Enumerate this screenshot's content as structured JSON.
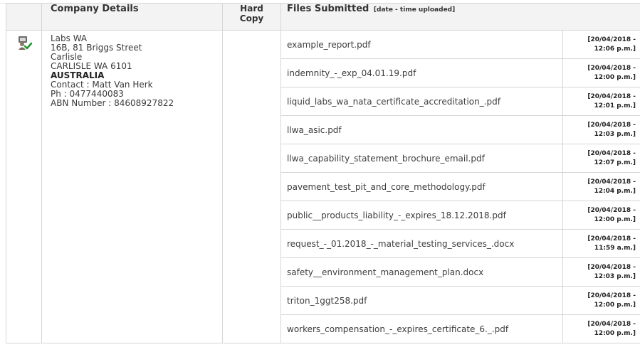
{
  "table": {
    "headers": {
      "company_details": "Company Details",
      "hard_copy_line1": "Hard",
      "hard_copy_line2": "Copy",
      "files_submitted": "Files Submitted",
      "files_submitted_sub": "[date - time uploaded]"
    },
    "row_icon": "user-check-icon",
    "company": {
      "name": "Labs WA",
      "address_line1": "16B, 81 Briggs Street",
      "suburb": "Carlisle",
      "city_state_postcode": "CARLISLE  WA 6101",
      "country": "AUSTRALIA",
      "contact": "Contact : Matt Van Herk",
      "phone": "Ph : 0477440083",
      "abn": "ABN Number : 84608927822"
    },
    "files": [
      {
        "name": "example_report.pdf",
        "date": "[20/04/2018 -",
        "time": "12:06 p.m.]"
      },
      {
        "name": "indemnity_-_exp_04.01.19.pdf",
        "date": "[20/04/2018 -",
        "time": "12:00 p.m.]"
      },
      {
        "name": "liquid_labs_wa_nata_certificate_accreditation_.pdf",
        "date": "[20/04/2018 -",
        "time": "12:01 p.m.]"
      },
      {
        "name": "llwa_asic.pdf",
        "date": "[20/04/2018 -",
        "time": "12:03 p.m.]"
      },
      {
        "name": "llwa_capability_statement_brochure_email.pdf",
        "date": "[20/04/2018 -",
        "time": "12:07 p.m.]"
      },
      {
        "name": "pavement_test_pit_and_core_methodology.pdf",
        "date": "[20/04/2018 -",
        "time": "12:04 p.m.]"
      },
      {
        "name": "public__products_liability_-_expires_18.12.2018.pdf",
        "date": "[20/04/2018 -",
        "time": "12:00 p.m.]"
      },
      {
        "name": "request_-_01.2018_-_material_testing_services_.docx",
        "date": "[20/04/2018 -",
        "time": "11:59 a.m.]"
      },
      {
        "name": "safety__environment_management_plan.docx",
        "date": "[20/04/2018 -",
        "time": "12:03 p.m.]"
      },
      {
        "name": "triton_1ggt258.pdf",
        "date": "[20/04/2018 -",
        "time": "12:00 p.m.]"
      },
      {
        "name": "workers_compensation_-_expires_certificate_6._.pdf",
        "date": "[20/04/2018 -",
        "time": "12:00 p.m.]"
      }
    ]
  }
}
